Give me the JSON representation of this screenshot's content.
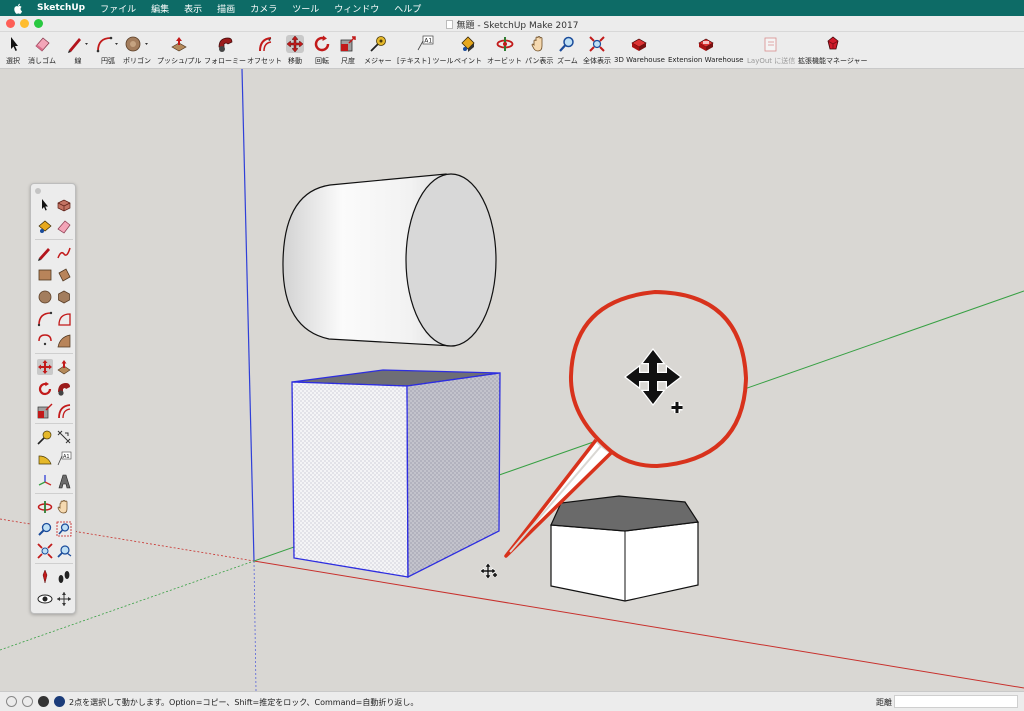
{
  "menubar": {
    "app_name": "SketchUp",
    "items": [
      "ファイル",
      "編集",
      "表示",
      "描画",
      "カメラ",
      "ツール",
      "ウィンドウ",
      "ヘルプ"
    ]
  },
  "window": {
    "title": "無題 - SketchUp Make 2017"
  },
  "toolbar": {
    "items": [
      {
        "label": "選択",
        "icon": "select-arrow-icon"
      },
      {
        "label": "消しゴム",
        "icon": "eraser-icon"
      },
      {
        "label": "線",
        "icon": "pencil-line-icon"
      },
      {
        "label": "円弧",
        "icon": "arc-icon"
      },
      {
        "label": "ポリゴン",
        "icon": "polygon-icon"
      },
      {
        "label": "プッシュ/プル",
        "icon": "push-pull-icon"
      },
      {
        "label": "フォローミー",
        "icon": "follow-me-icon"
      },
      {
        "label": "オフセット",
        "icon": "offset-icon"
      },
      {
        "label": "移動",
        "icon": "move-icon",
        "active": true
      },
      {
        "label": "回転",
        "icon": "rotate-icon"
      },
      {
        "label": "尺度",
        "icon": "scale-icon"
      },
      {
        "label": "メジャー",
        "icon": "tape-measure-icon"
      },
      {
        "label": "[テキスト] ツール",
        "icon": "text-tool-icon"
      },
      {
        "label": "ペイント",
        "icon": "paint-bucket-icon"
      },
      {
        "label": "オービット",
        "icon": "orbit-icon"
      },
      {
        "label": "パン表示",
        "icon": "pan-hand-icon"
      },
      {
        "label": "ズーム",
        "icon": "zoom-icon"
      },
      {
        "label": "全体表示",
        "icon": "zoom-extents-icon"
      },
      {
        "label": "3D Warehouse",
        "icon": "3d-warehouse-icon"
      },
      {
        "label": "Extension Warehouse",
        "icon": "extension-warehouse-icon"
      },
      {
        "label": "LayOut に送信",
        "icon": "send-to-layout-icon",
        "disabled": true
      },
      {
        "label": "拡張機能マネージャー",
        "icon": "extension-manager-icon"
      }
    ]
  },
  "callout": {
    "icon": "move-cursor-copy-icon"
  },
  "palette": {
    "tools": [
      "select-arrow-icon",
      "make-component-icon",
      "paint-bucket-icon",
      "eraser-icon",
      "pencil-line-icon",
      "freehand-icon",
      "rectangle-icon",
      "rotated-rectangle-icon",
      "circle-icon",
      "polygon-icon",
      "arc-icon",
      "pie-icon",
      "three-point-arc-icon",
      "two-point-arc-icon",
      "move-icon",
      "push-pull-icon",
      "rotate-icon",
      "follow-me-icon",
      "scale-icon",
      "offset-icon",
      "tape-measure-icon",
      "dimension-icon",
      "protractor-icon",
      "text-tool-icon",
      "axes-icon",
      "3d-text-icon",
      "orbit-icon",
      "pan-hand-icon",
      "zoom-icon",
      "zoom-window-icon",
      "zoom-extents-icon",
      "previous-view-icon",
      "position-camera-icon",
      "walk-icon",
      "look-around-icon",
      "section-plane-icon"
    ]
  },
  "statusbar": {
    "message": "2点を選択して動かします。Option=コピー、Shift=推定をロック、Command=自動折り返し。",
    "measurement_label": "距離",
    "measurement_value": ""
  }
}
